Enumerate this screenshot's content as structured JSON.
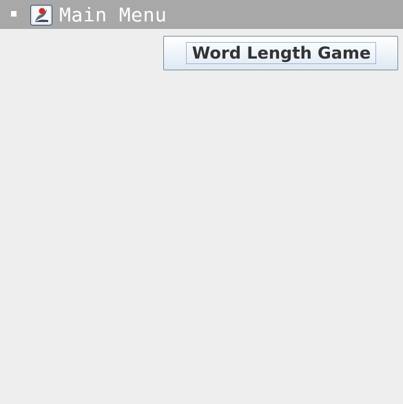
{
  "window": {
    "title": "Main Menu",
    "icons": {
      "window_menu": "window-menu-square-icon",
      "app": "java-app-icon"
    }
  },
  "content": {
    "game_button_label": "Word Length Game"
  },
  "colors": {
    "titlebar": "#a8a8a8",
    "title_text": "#ffffff",
    "background": "#eeeeee",
    "button_border": "#7a8a99",
    "button_text": "#333333"
  }
}
